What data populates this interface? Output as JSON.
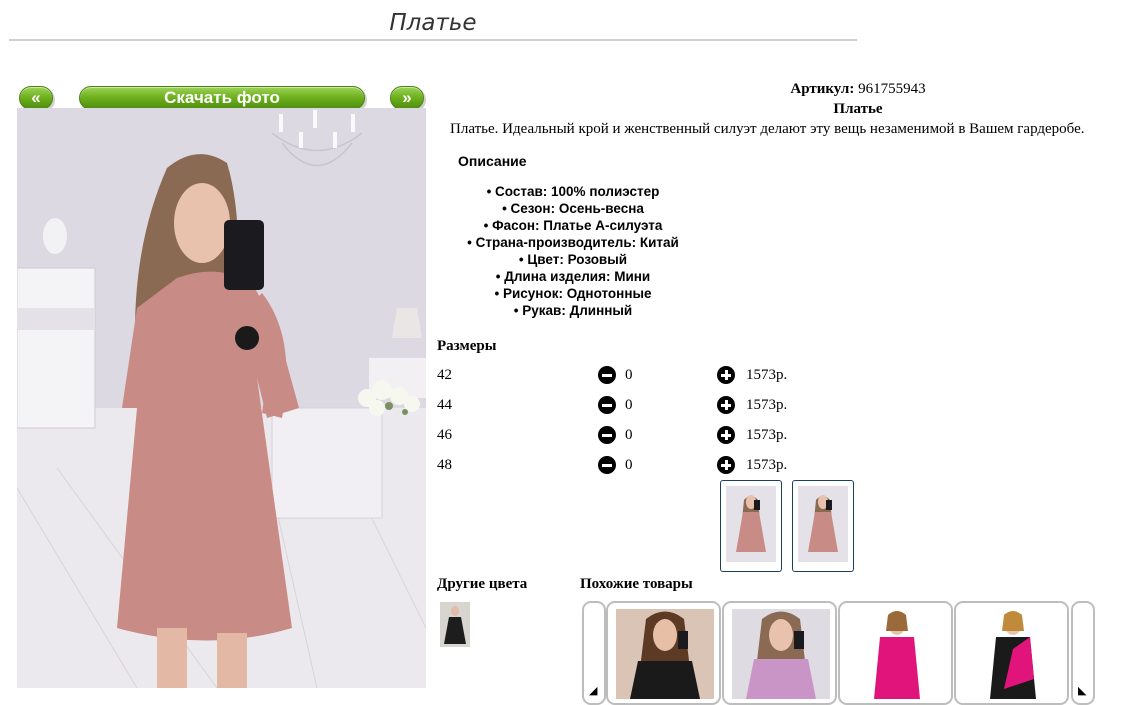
{
  "page": {
    "title": "Платье"
  },
  "gallery": {
    "prev_label": "«",
    "download_label": "Скачать фото",
    "next_label": "»"
  },
  "product": {
    "sku_label": "Артикул:",
    "sku_value": "961755943",
    "name": "Платье",
    "short_description": "Платье. Идеальный крой и женственный силуэт делают эту вещь незаменимой в Вашем гардеробе.",
    "description_heading": "Описание",
    "specs": [
      "Состав: 100% полиэстер",
      "Сезон: Осень-весна",
      "Фасон: Платье А-силуэта",
      "Страна-производитель: Китай",
      "Цвет: Розовый",
      "Длина изделия: Мини",
      "Рисунок: Однотонные",
      "Рукав: Длинный"
    ]
  },
  "sizes": {
    "heading": "Размеры",
    "rows": [
      {
        "size": "42",
        "qty": "0",
        "price": "1573р."
      },
      {
        "size": "44",
        "qty": "0",
        "price": "1573р."
      },
      {
        "size": "46",
        "qty": "0",
        "price": "1573р."
      },
      {
        "size": "48",
        "qty": "0",
        "price": "1573р."
      }
    ]
  },
  "sections": {
    "other_colors": "Другие цвета",
    "similar": "Похожие товары"
  },
  "icons": {
    "minus": "minus-circle-icon",
    "plus": "plus-circle-icon",
    "carousel_left": "arrow-left-icon",
    "carousel_right": "arrow-right-icon"
  },
  "colors": {
    "button_green": "#6fb21e",
    "dress_pink": "#c98b86",
    "thumb_border": "#1e3f5f"
  }
}
